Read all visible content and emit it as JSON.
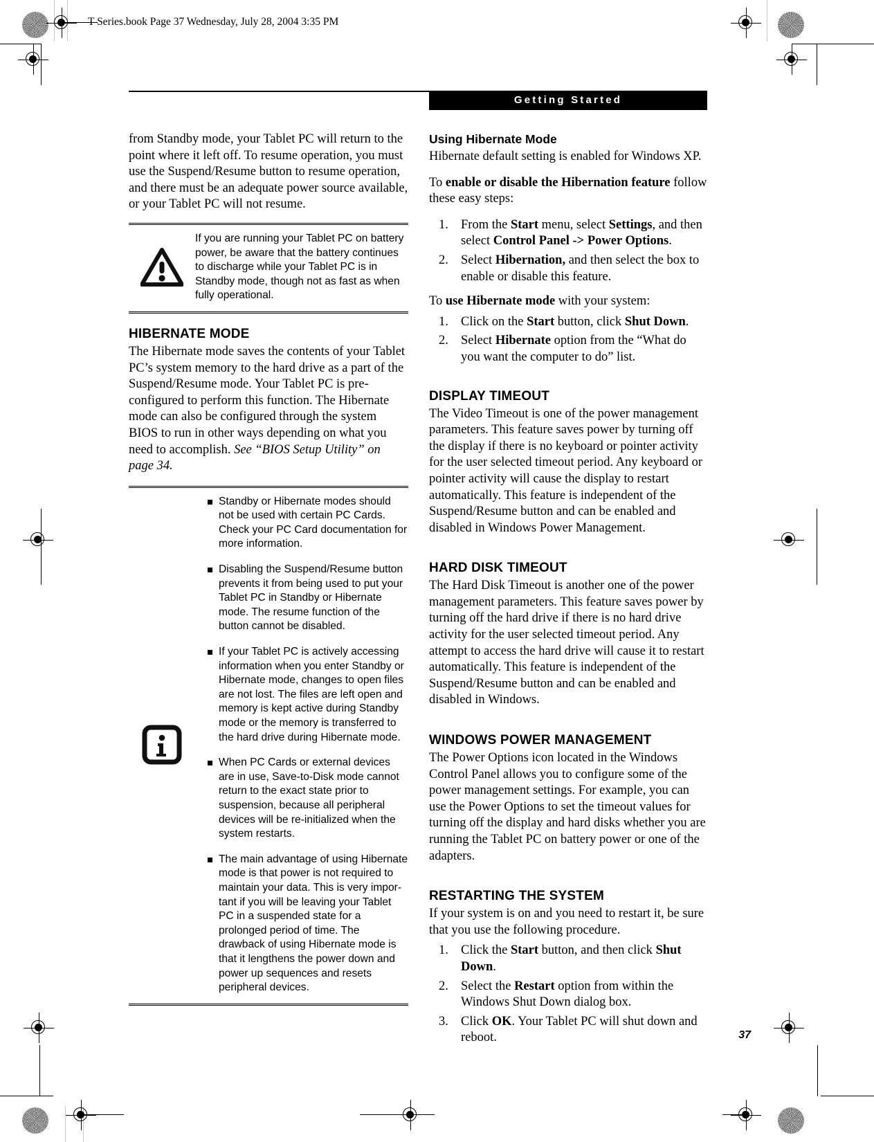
{
  "page": {
    "file_stamp": "T Series.book  Page 37  Wednesday, July 28, 2004  3:35 PM",
    "section_bar": "Getting Started",
    "page_number": "37"
  },
  "left_column": {
    "intro_paragraph": "from Standby mode, your Tablet PC will return to the point where it left off. To resume operation, you must use the Suspend/Resume button to resume operation, and there must be an adequate power source available, or your Tablet PC will not resume.",
    "caution_box": {
      "icon": "warning-triangle-icon",
      "text": "If you are running your Tablet PC on battery power, be aware that the battery continues to discharge while your Tablet PC is in Standby mode, though not as fast as when fully operational."
    },
    "hibernate_heading": "HIBERNATE MODE",
    "hibernate_paragraph_pre": "The Hibernate mode saves the contents of your Tablet PC’s system memory to the hard drive as a part of the Suspend/Resume mode. Your Tablet PC is pre-configured to perform this function. The Hibernate mode can also be configured through the system BIOS to run in other ways depending on what you need to accomplish. ",
    "hibernate_paragraph_italic": "See “BIOS Setup Utility” on page 34.",
    "info_box": {
      "icon": "info-icon",
      "bullets": [
        "Standby or Hibernate modes should not be used with certain PC Cards. Check your PC Card documentation for more information.",
        "Disabling the Suspend/Resume button prevents it from being used to put your Tablet PC in Standby or Hibernate mode. The resume function of the button cannot be disabled.",
        "If your Tablet PC is actively accessing information when you enter Standby or Hibernate mode, changes to open files are not lost. The files are left open and memory is kept active during Standby mode or the memory is transferred to the hard drive during Hibernate mode.",
        "When PC Cards or external devices are in use, Save-to-Disk mode cannot return to the exact state prior to suspension, because all peripheral devices will be re-initialized when the system restarts.",
        "The main advantage of using Hibernate mode is that power is not required to maintain your data. This is very impor-tant if you will be leaving your Tablet PC in a suspended state for a prolonged period of time. The drawback of using Hibernate mode is that it lengthens the power down and power up sequences and resets peripheral devices."
      ]
    }
  },
  "right_column": {
    "using_hibernate": {
      "subheading": "Using Hibernate Mode",
      "paragraph": "Hibernate default setting is enabled for Windows XP.",
      "enable_intro_pre": "To ",
      "enable_intro_bold": "enable or disable the Hibernation feature",
      "enable_intro_post": " follow these easy steps:",
      "enable_steps": [
        {
          "parts": [
            {
              "t": "From the ",
              "b": false
            },
            {
              "t": "Start",
              "b": true
            },
            {
              "t": " menu, select ",
              "b": false
            },
            {
              "t": "Settings",
              "b": true
            },
            {
              "t": ", and then select ",
              "b": false
            },
            {
              "t": "Control Panel -> Power Options",
              "b": true
            },
            {
              "t": ".",
              "b": false
            }
          ]
        },
        {
          "parts": [
            {
              "t": "Select ",
              "b": false
            },
            {
              "t": "Hibernation,",
              "b": true
            },
            {
              "t": " and then select the box to enable or disable this feature.",
              "b": false
            }
          ]
        }
      ],
      "use_intro_pre": "To ",
      "use_intro_bold": "use Hibernate mode",
      "use_intro_post": " with your system:",
      "use_steps": [
        {
          "parts": [
            {
              "t": "Click on the ",
              "b": false
            },
            {
              "t": "Start",
              "b": true
            },
            {
              "t": " button, click ",
              "b": false
            },
            {
              "t": "Shut Down",
              "b": true
            },
            {
              "t": ".",
              "b": false
            }
          ]
        },
        {
          "parts": [
            {
              "t": "Select ",
              "b": false
            },
            {
              "t": "Hibernate",
              "b": true
            },
            {
              "t": " option from the “What do you want the computer to do” list.",
              "b": false
            }
          ]
        }
      ]
    },
    "display_timeout": {
      "heading": "DISPLAY TIMEOUT",
      "paragraph": "The Video Timeout is one of the power management parameters. This feature saves power by turning off the display if there is no keyboard or pointer activity for the user selected timeout period. Any keyboard or pointer activity will cause the display to restart automatically. This feature is independent of the Suspend/Resume button and can be enabled and disabled in Windows Power Management."
    },
    "hard_disk_timeout": {
      "heading": "HARD DISK TIMEOUT",
      "paragraph": "The Hard Disk Timeout is another one of the power management parameters. This feature saves power by turning off the hard drive if there is no hard drive activity for the user selected timeout period. Any attempt to access the hard drive will cause it to restart automatically. This feature is independent of the Suspend/Resume button and can be enabled and disabled in Windows."
    },
    "windows_power_management": {
      "heading": "WINDOWS POWER MANAGEMENT",
      "paragraph": "The Power Options icon located in the Windows Control Panel allows you to configure some of the power management settings. For example, you can use the Power Options to set the timeout values for turning off the display and hard disks whether you are running the Tablet PC on battery power or one of the adapters."
    },
    "restarting_the_system": {
      "heading": "RESTARTING THE SYSTEM",
      "paragraph": "If your system is on and you need to restart it, be sure that you use the following procedure.",
      "steps": [
        {
          "parts": [
            {
              "t": "Click the ",
              "b": false
            },
            {
              "t": "Start",
              "b": true
            },
            {
              "t": " button, and then click ",
              "b": false
            },
            {
              "t": "Shut Down",
              "b": true
            },
            {
              "t": ".",
              "b": false
            }
          ]
        },
        {
          "parts": [
            {
              "t": "Select the ",
              "b": false
            },
            {
              "t": "Restart",
              "b": true
            },
            {
              "t": " option from within the Windows Shut Down dialog box.",
              "b": false
            }
          ]
        },
        {
          "parts": [
            {
              "t": "Click ",
              "b": false
            },
            {
              "t": "OK",
              "b": true
            },
            {
              "t": ". Your Tablet PC will shut down and reboot.",
              "b": false
            }
          ]
        }
      ]
    }
  },
  "colors": {
    "ink": "#000000",
    "paper": "#ffffff",
    "bar_bg": "#000000",
    "bar_text": "#ffffff"
  }
}
